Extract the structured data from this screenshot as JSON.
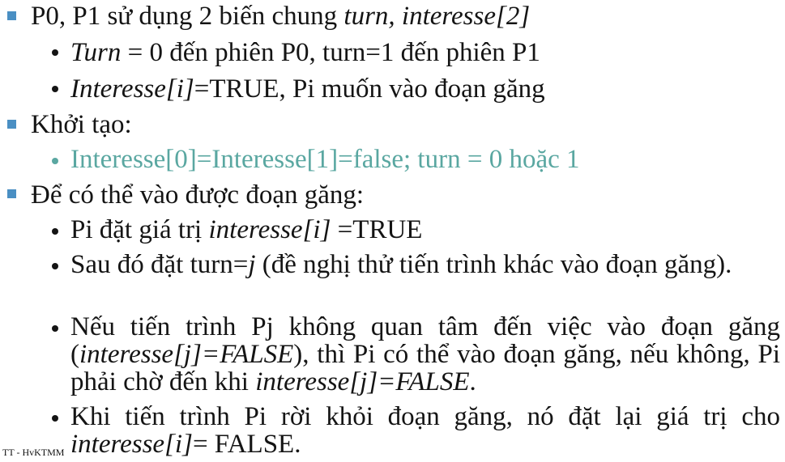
{
  "bullets": {
    "b1": {
      "text_a": "P0, P1 sử dụng 2 biến chung ",
      "text_b": "turn, interesse[2]",
      "sub1": {
        "italic": "Turn",
        "text": " = 0 đến phiên P0, turn=1 đến phiên P1"
      },
      "sub2": {
        "italic": "Interesse[i]",
        "text": "=TRUE, Pi muốn vào đoạn găng"
      }
    },
    "b2": {
      "text": "Khởi tạo:",
      "sub1": {
        "text": "Interesse[0]=Interesse[1]=false; turn = 0 hoặc 1"
      }
    },
    "b3": {
      "text": "Để có thể vào được đoạn găng:",
      "sub1": {
        "text_a": "Pi đặt giá trị ",
        "italic": "interesse[i] ",
        "text_b": "=TRUE"
      },
      "sub2": {
        "text_a": "Sau đó đặt turn=",
        "italic": "j",
        "text_b": " (đề nghị thử tiến trình khác vào đoạn găng)."
      },
      "sub3": {
        "text_a": "Nếu tiến trình Pj không quan tâm đến việc vào đoạn găng (",
        "italic_a": "interesse[j]=FALSE",
        "text_b": "), thì Pi có thể vào đoạn găng, nếu không, Pi phải chờ đến khi ",
        "italic_b": "interesse[j]=FALSE",
        "text_c": "."
      },
      "sub4": {
        "text_a": "Khi tiến trình Pi rời khỏi đoạn găng, nó đặt lại giá trị cho ",
        "italic": "interesse[i]",
        "text_b": "= FALSE."
      }
    }
  },
  "footer": {
    "text": "TT - HvKTMM"
  },
  "colors": {
    "bullet_square": "#4a8fc3",
    "highlight_text": "#5aa7a1",
    "text": "#141414"
  }
}
